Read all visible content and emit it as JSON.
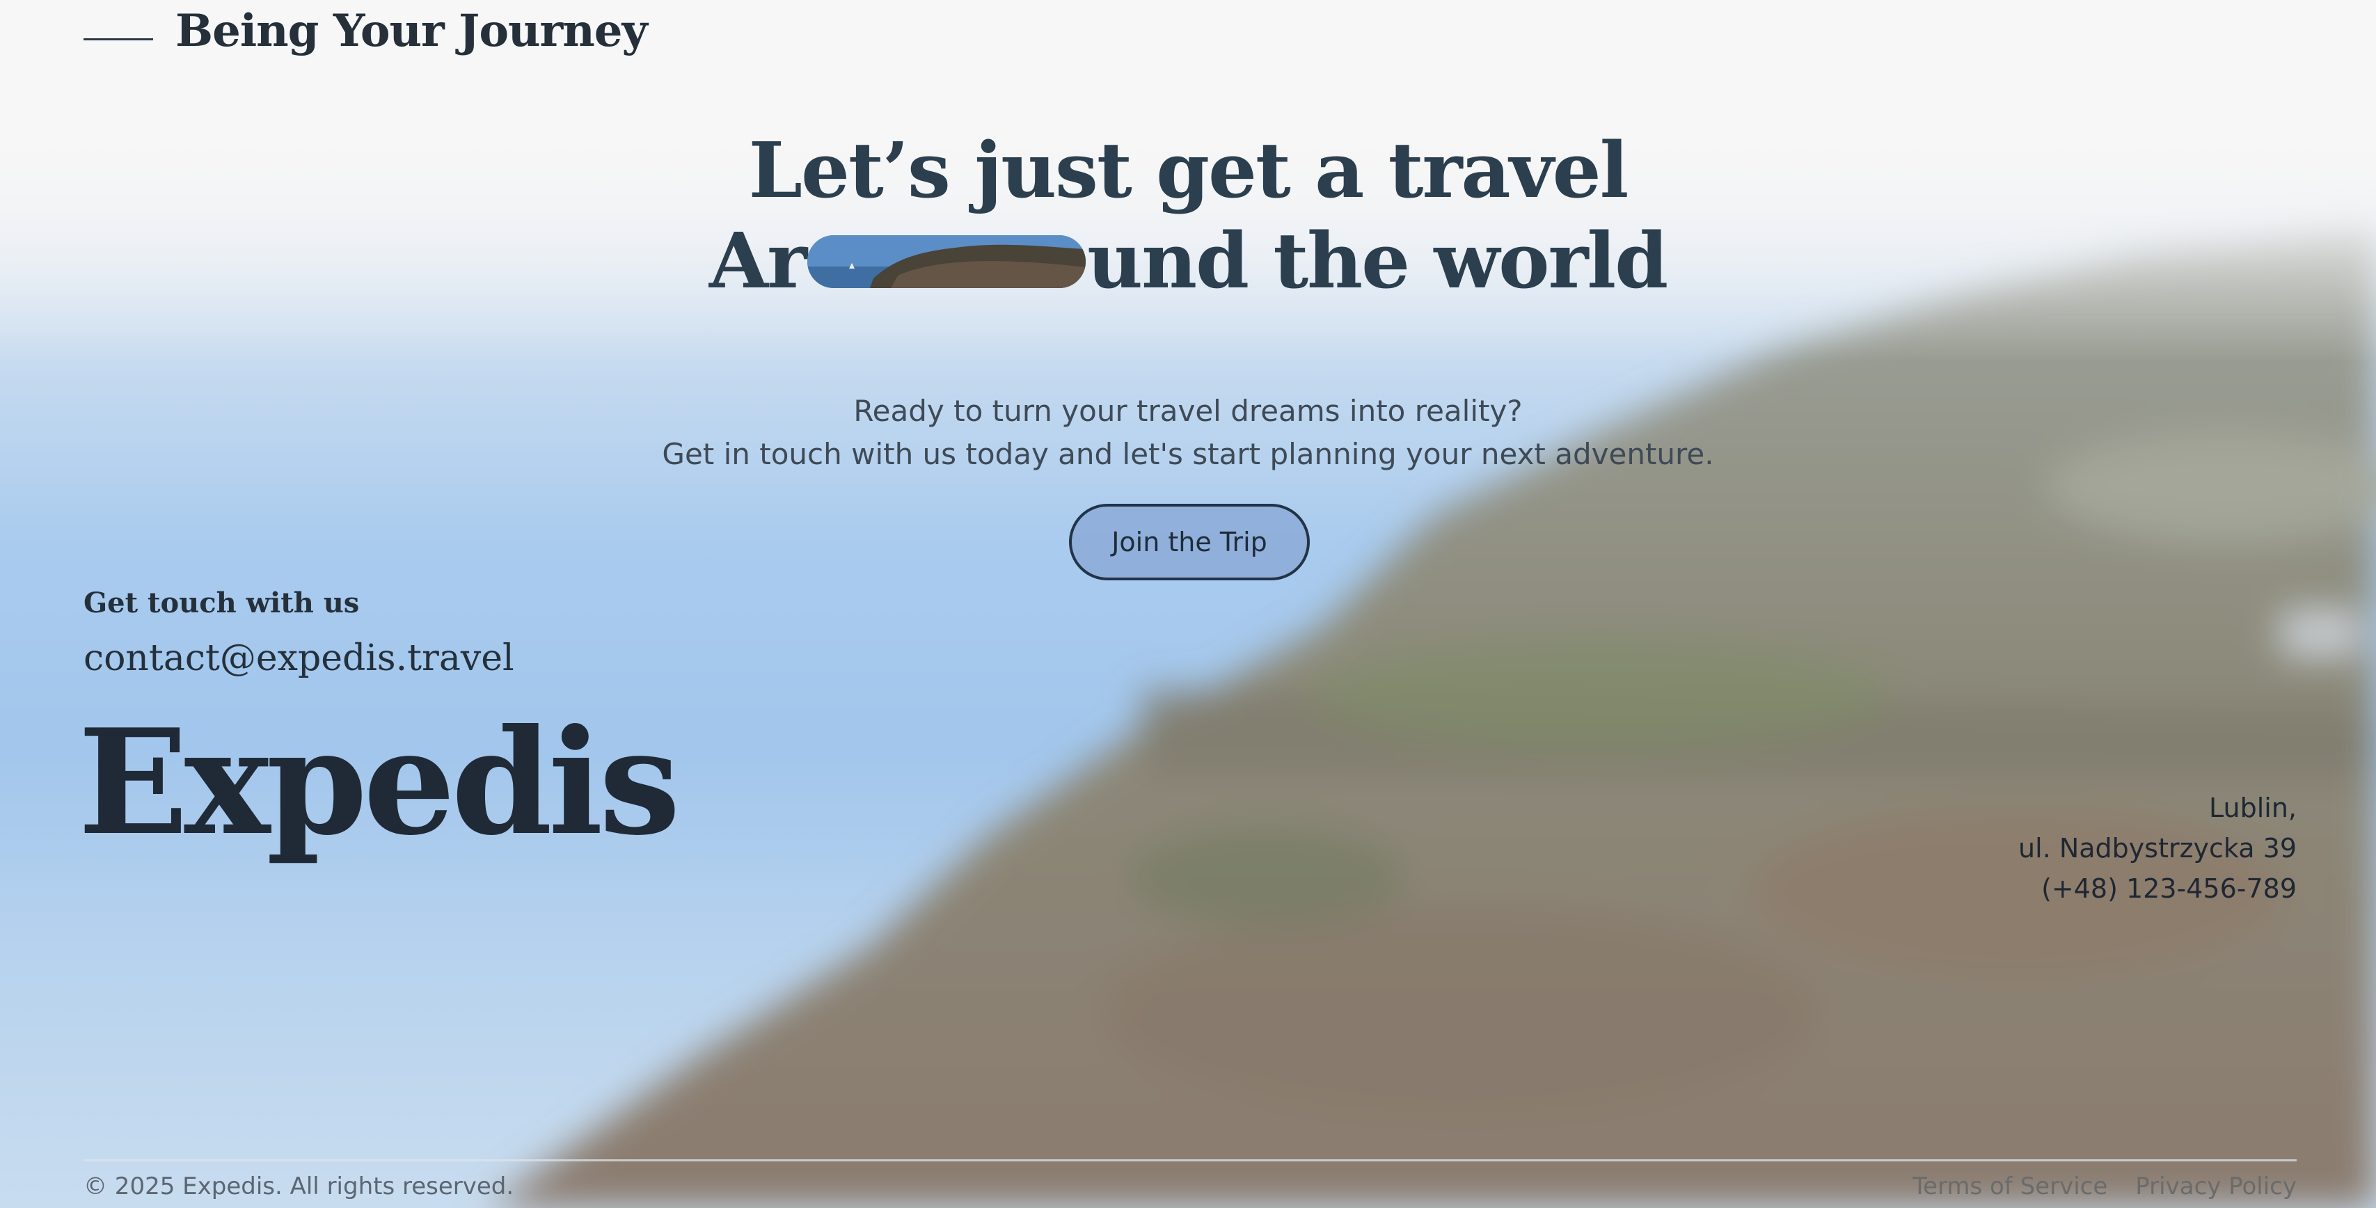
{
  "header": {
    "title": "Being Your Journey"
  },
  "hero": {
    "line1": "Let’s just get a travel",
    "line2_prefix": "Ar",
    "line2_suffix": "und the world",
    "subtitle_line1": "Ready to turn your travel dreams into reality?",
    "subtitle_line2": "Get in touch with us today and let's start planning your next adventure.",
    "cta_label": "Join the Trip"
  },
  "contact": {
    "label": "Get touch with us",
    "email": "contact@expedis.travel"
  },
  "brand": {
    "name": "Expedis"
  },
  "address": {
    "city": "Lublin,",
    "street": "ul. Nadbystrzycka 39",
    "phone": "(+48) 123-456-789"
  },
  "footer": {
    "copyright": "© 2025 Expedis. All rights reserved.",
    "links": [
      "Terms of Service",
      "Privacy Policy"
    ]
  },
  "colors": {
    "heading": "#2b3f4f",
    "text": "#25303b",
    "cta_bg": "#8caad7",
    "cta_border": "#223447"
  }
}
